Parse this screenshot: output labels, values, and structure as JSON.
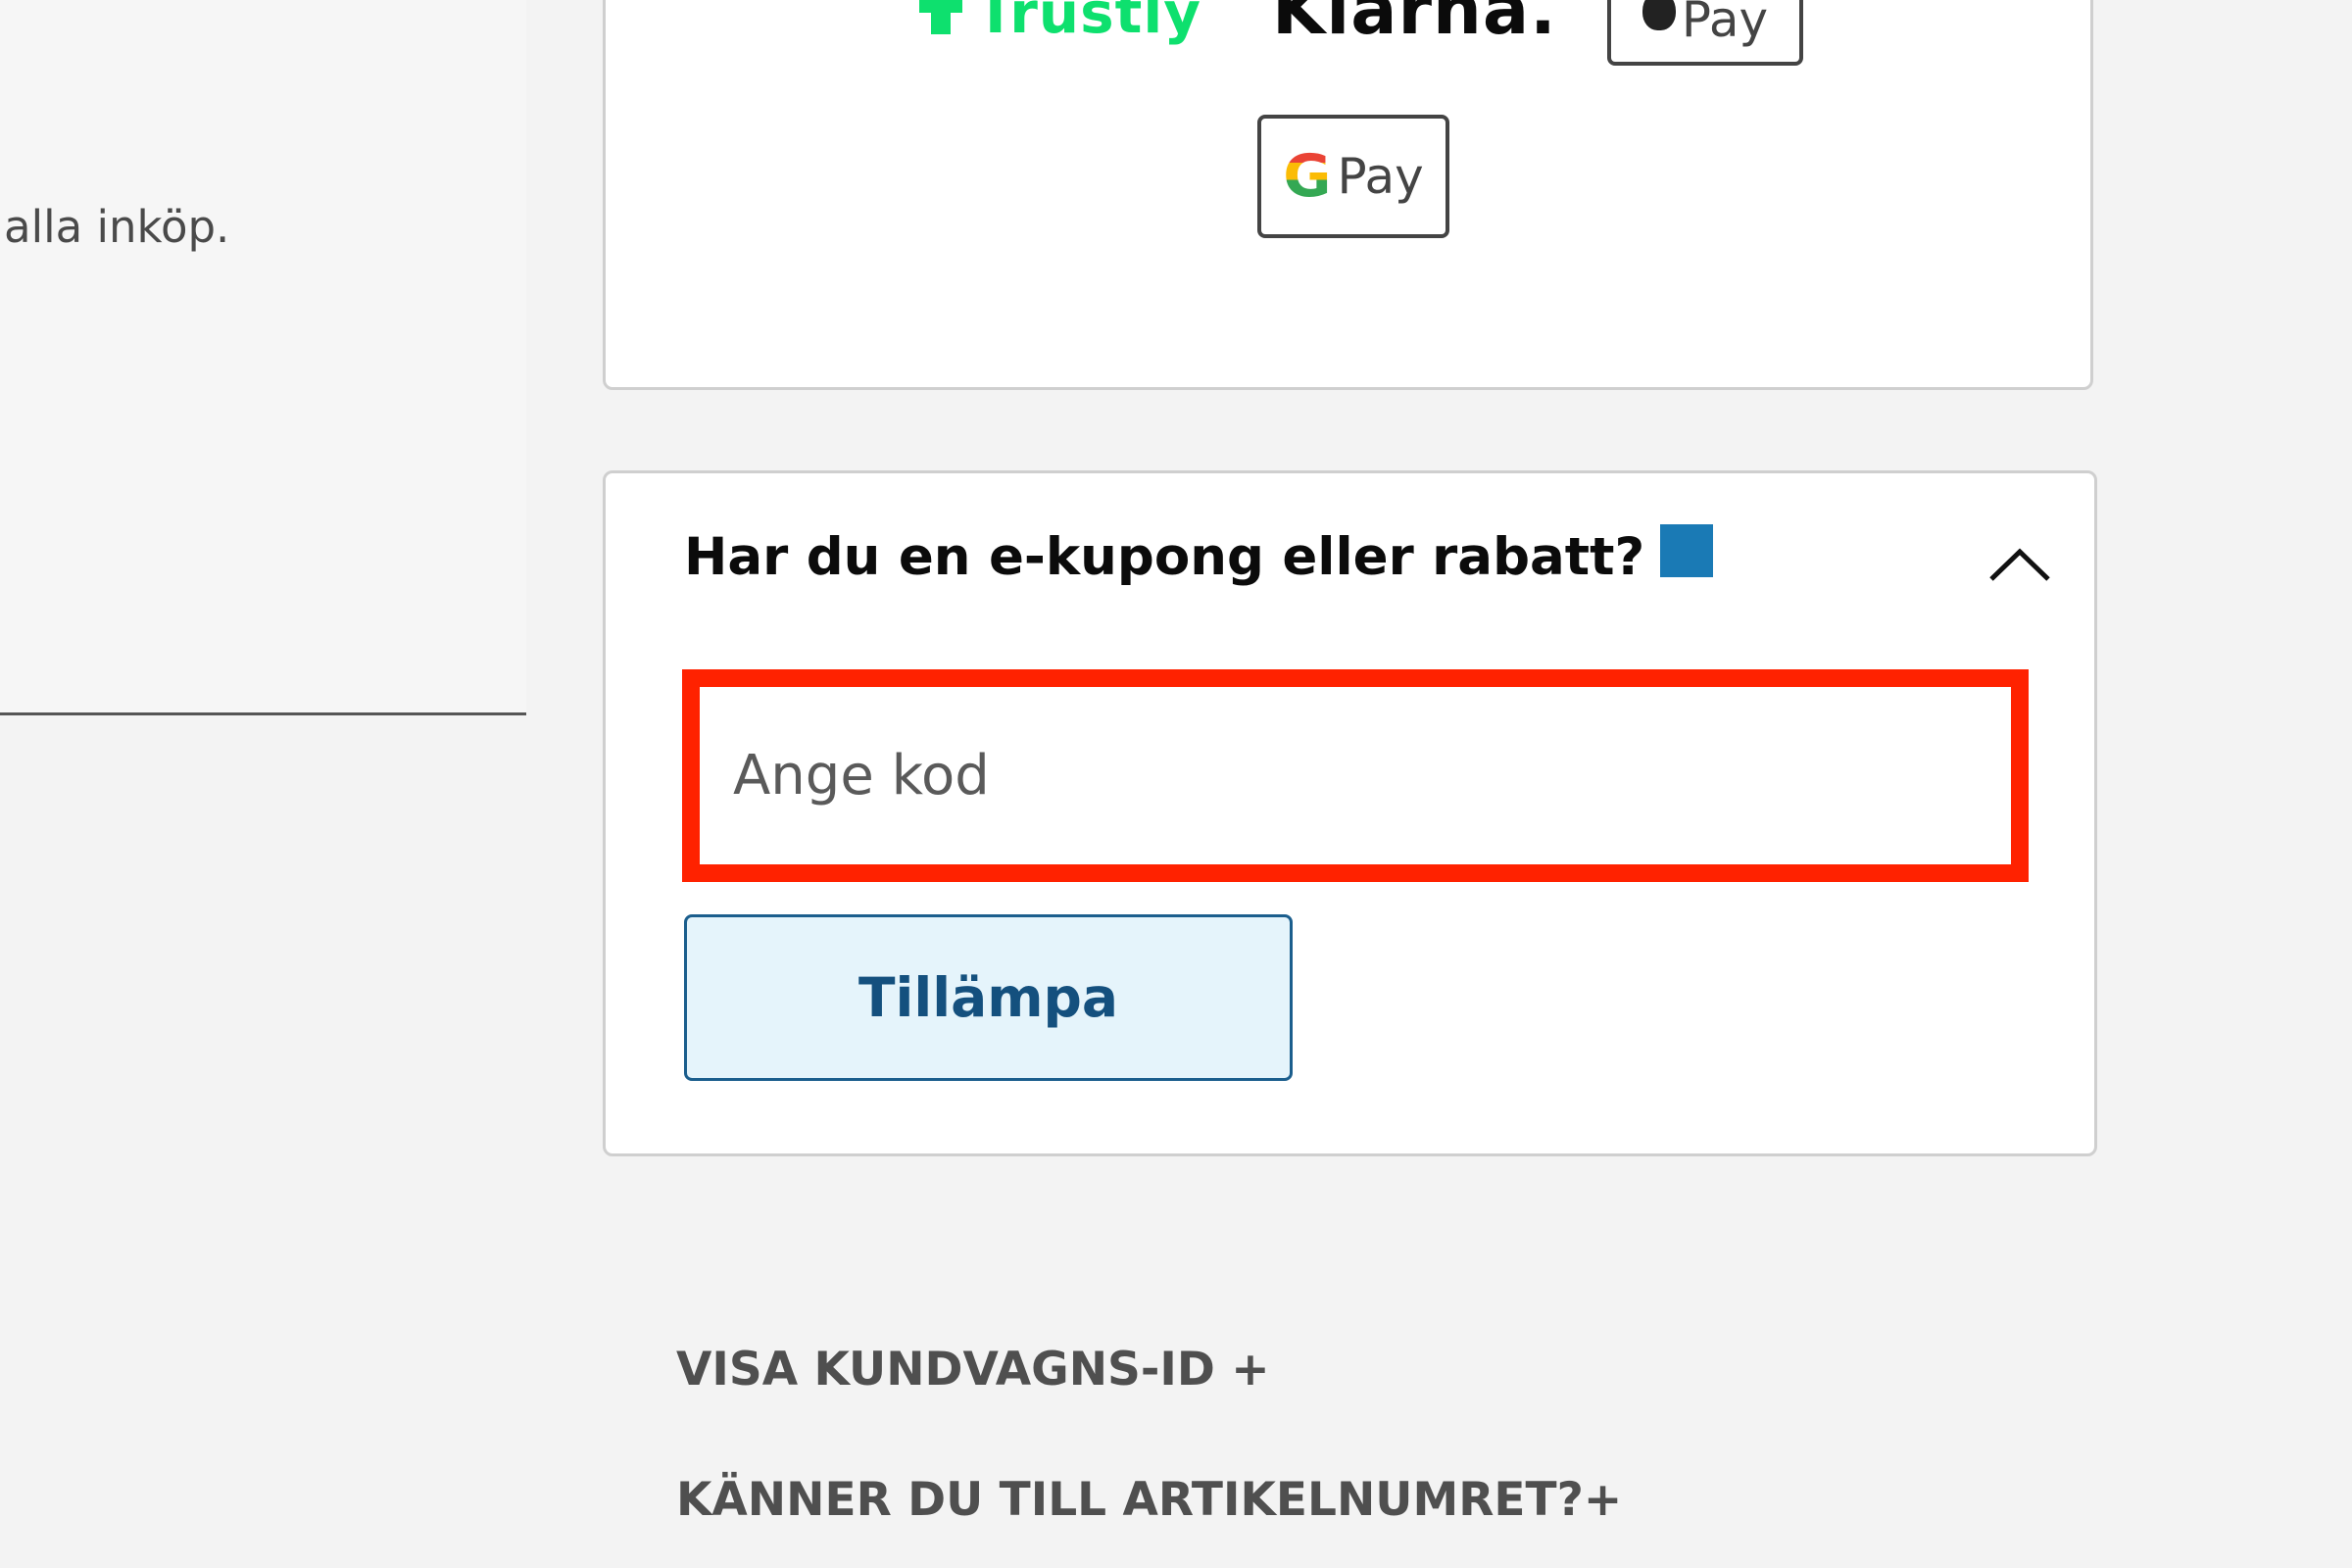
{
  "left_panel": {
    "text": "alla inköp."
  },
  "payment_methods": {
    "trustly": "Trustly",
    "klarna": "Klarna.",
    "apple_pay": "Pay",
    "google_pay": "Pay",
    "google_g": "G"
  },
  "coupon": {
    "title": "Har du en e-kupong eller rabatt?",
    "input_placeholder": "Ange kod",
    "apply_label": "Tillämpa",
    "accent_color": "#1a7ab5",
    "highlight_color": "#ff2200"
  },
  "links": {
    "cart_id": "VISA KUNDVAGNS-ID +",
    "article_number": "KÄNNER DU TILL ARTIKELNUMRET?+"
  }
}
